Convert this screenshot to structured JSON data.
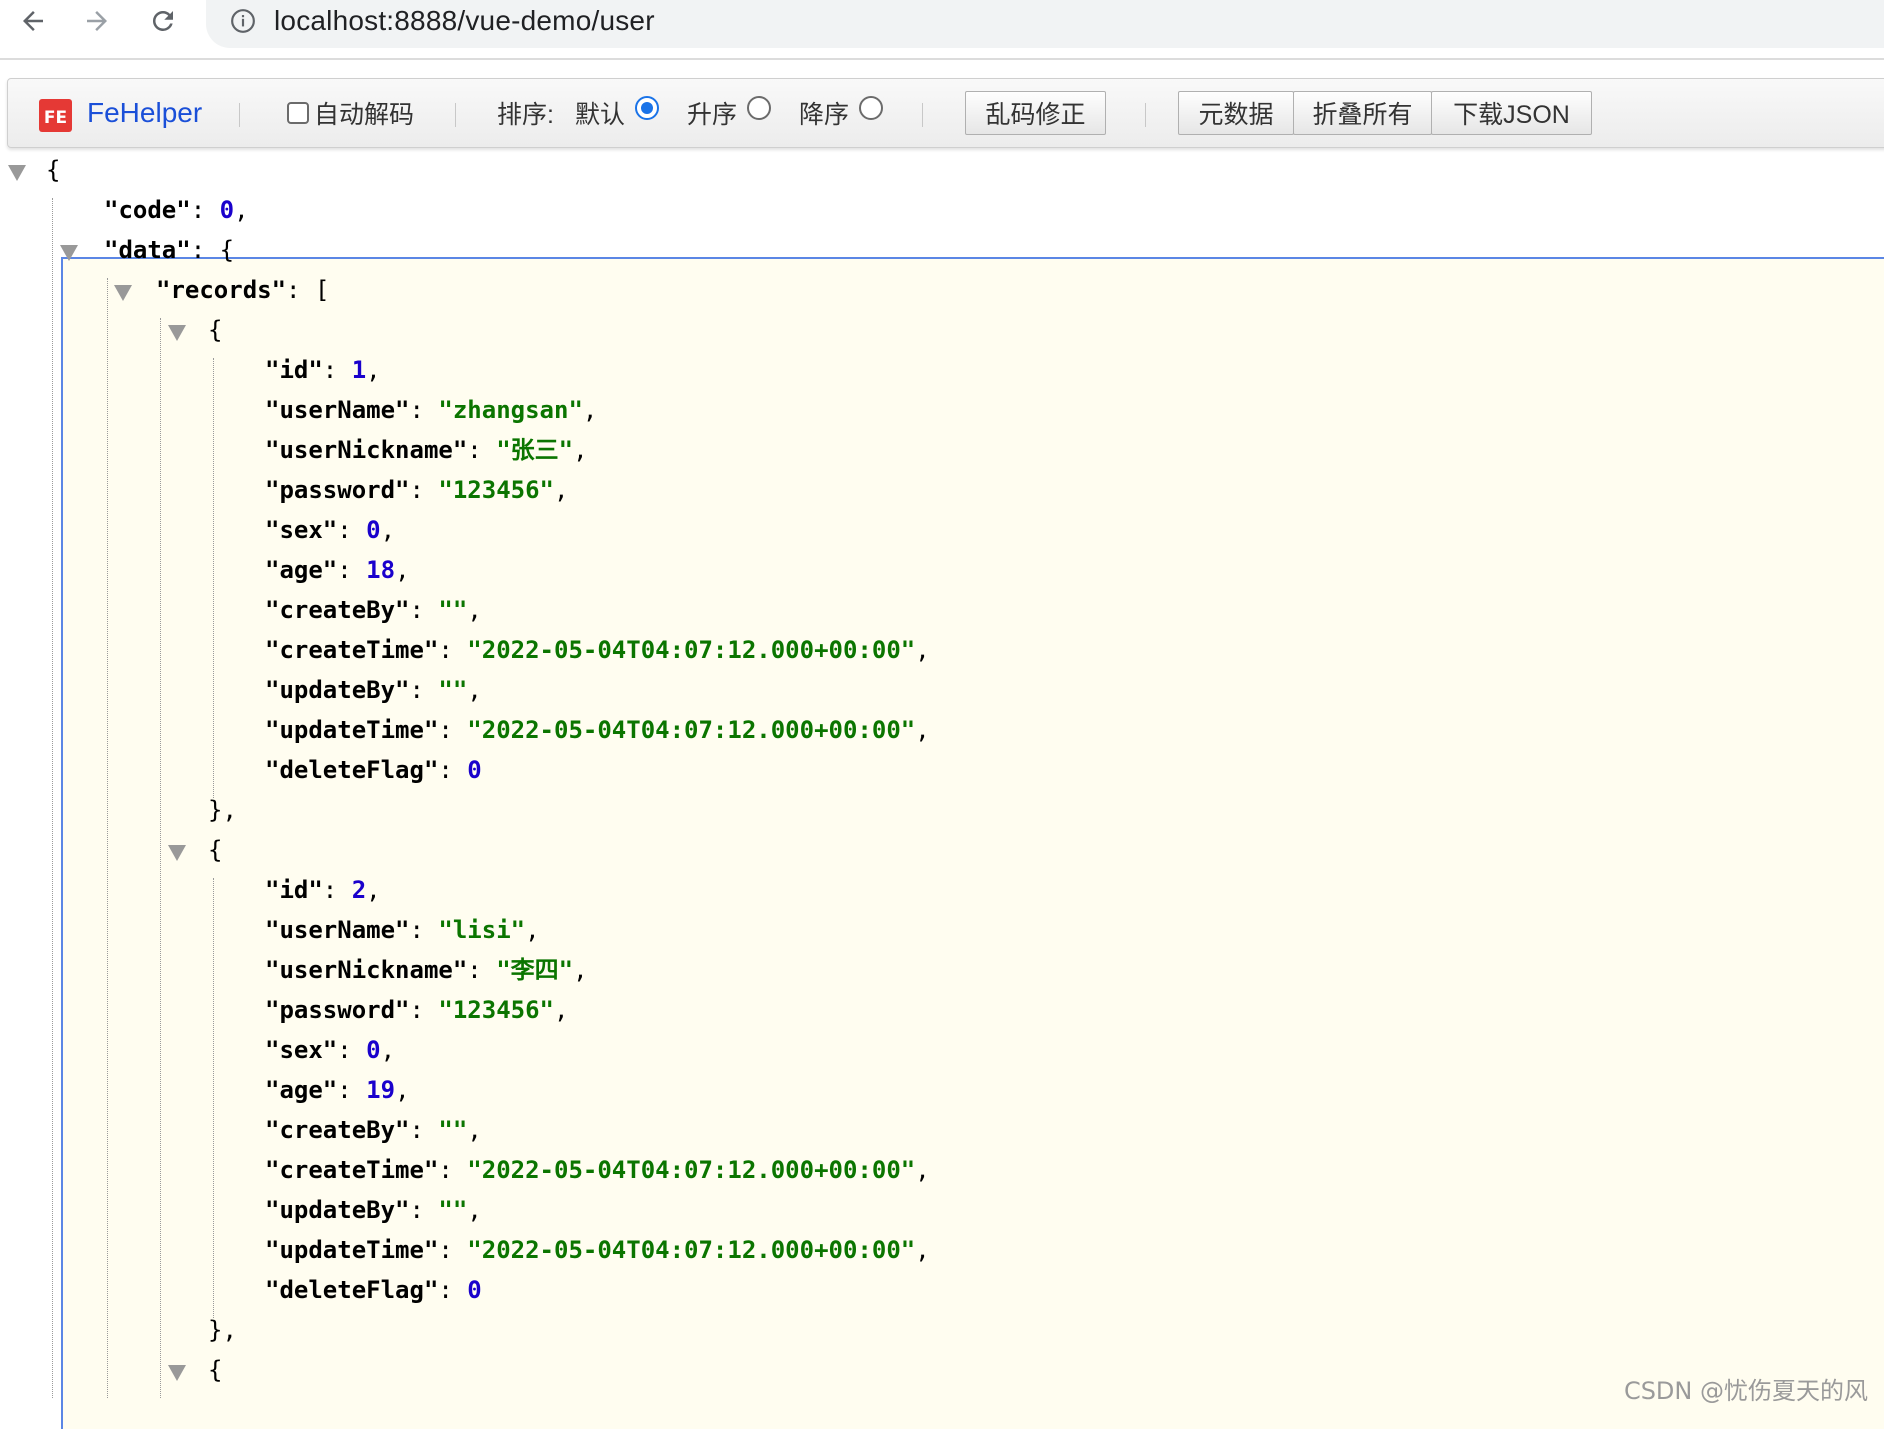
{
  "browser": {
    "url": "localhost:8888/vue-demo/user"
  },
  "toolbar": {
    "brand": "FeHelper",
    "auto_decode": "自动解码",
    "sort_label": "排序:",
    "sort_default": "默认",
    "sort_asc": "升序",
    "sort_desc": "降序",
    "fix_encoding": "乱码修正",
    "metadata": "元数据",
    "collapse_all": "折叠所有",
    "download_json": "下载JSON",
    "selected_sort": "默认"
  },
  "json": {
    "code": 0,
    "records": [
      {
        "id": 1,
        "userName": "zhangsan",
        "userNickname": "张三",
        "password": "123456",
        "sex": 0,
        "age": 18,
        "createBy": "",
        "createTime": "2022-05-04T04:07:12.000+00:00",
        "updateBy": "",
        "updateTime": "2022-05-04T04:07:12.000+00:00",
        "deleteFlag": 0
      },
      {
        "id": 2,
        "userName": "lisi",
        "userNickname": "李四",
        "password": "123456",
        "sex": 0,
        "age": 19,
        "createBy": "",
        "createTime": "2022-05-04T04:07:12.000+00:00",
        "updateBy": "",
        "updateTime": "2022-05-04T04:07:12.000+00:00",
        "deleteFlag": 0
      }
    ]
  },
  "watermark": "CSDN @忧伤夏天的风"
}
